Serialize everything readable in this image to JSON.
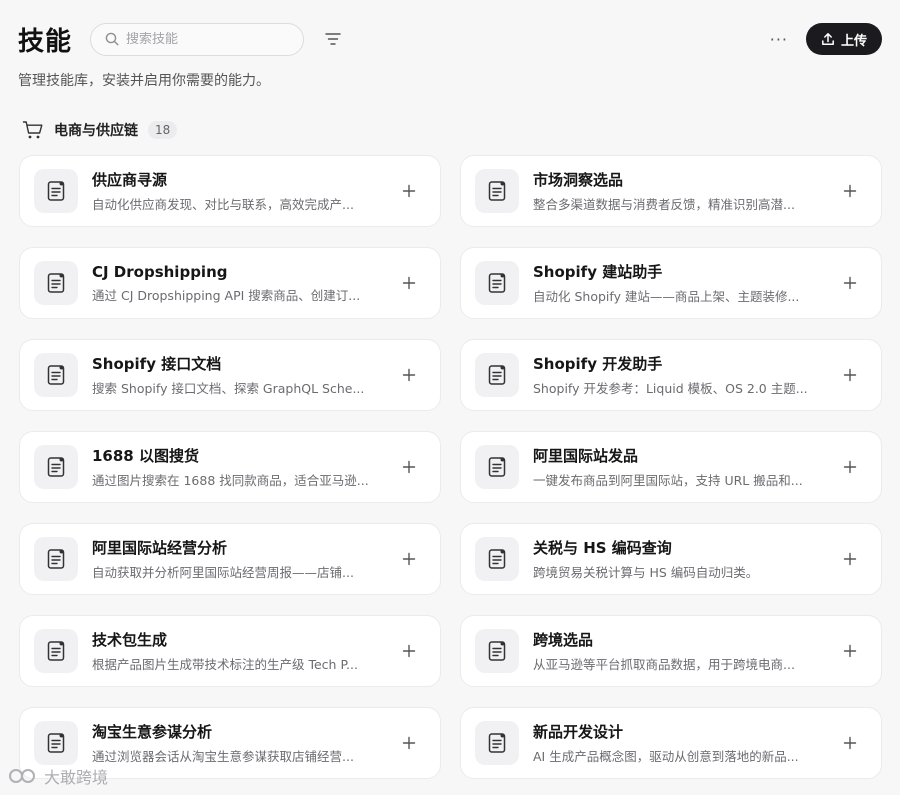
{
  "header": {
    "title": "技能",
    "search_placeholder": "搜索技能",
    "more_label": "···",
    "upload_label": "上传"
  },
  "subtitle": "管理技能库，安装并启用你需要的能力。",
  "section": {
    "title": "电商与供应链",
    "count": "18"
  },
  "skills": [
    {
      "title": "供应商寻源",
      "desc": "自动化供应商发现、对比与联系，高效完成产..."
    },
    {
      "title": "市场洞察选品",
      "desc": "整合多渠道数据与消费者反馈，精准识别高潜..."
    },
    {
      "title": "CJ Dropshipping",
      "desc": "通过 CJ Dropshipping API 搜索商品、创建订..."
    },
    {
      "title": "Shopify 建站助手",
      "desc": "自动化 Shopify 建站——商品上架、主题装修..."
    },
    {
      "title": "Shopify 接口文档",
      "desc": "搜索 Shopify 接口文档、探索 GraphQL Sche..."
    },
    {
      "title": "Shopify 开发助手",
      "desc": "Shopify 开发参考：Liquid 模板、OS 2.0 主题..."
    },
    {
      "title": "1688 以图搜货",
      "desc": "通过图片搜索在 1688 找同款商品，适合亚马逊..."
    },
    {
      "title": "阿里国际站发品",
      "desc": "一键发布商品到阿里国际站，支持 URL 搬品和..."
    },
    {
      "title": "阿里国际站经营分析",
      "desc": "自动获取并分析阿里国际站经营周报——店铺..."
    },
    {
      "title": "关税与 HS 编码查询",
      "desc": "跨境贸易关税计算与 HS 编码自动归类。"
    },
    {
      "title": "技术包生成",
      "desc": "根据产品图片生成带技术标注的生产级 Tech P..."
    },
    {
      "title": "跨境选品",
      "desc": "从亚马逊等平台抓取商品数据，用于跨境电商..."
    },
    {
      "title": "淘宝生意参谋分析",
      "desc": "通过浏览器会话从淘宝生意参谋获取店铺经营..."
    },
    {
      "title": "新品开发设计",
      "desc": "AI 生成产品概念图，驱动从创意到落地的新品..."
    }
  ],
  "watermark": "大敢跨境",
  "colors": {
    "background": "#f7f7f8",
    "card": "#ffffff",
    "primary_button": "#1b1b1f"
  },
  "icons": {
    "search": "search-icon",
    "filter": "filter-icon",
    "upload": "upload-icon",
    "cart": "shopping-cart-icon",
    "skill": "document-icon",
    "add": "plus-icon"
  }
}
